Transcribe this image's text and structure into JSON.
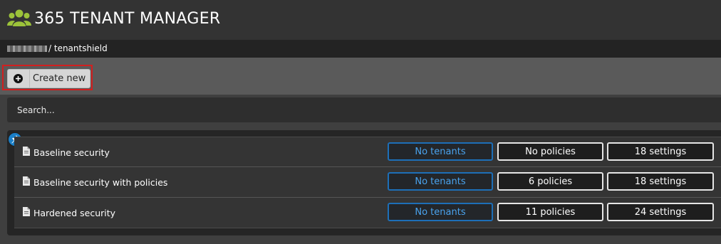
{
  "app": {
    "title": "365 TENANT MANAGER",
    "logo_icon": "users-group-icon",
    "accent_color": "#9cc33a"
  },
  "breadcrumb": {
    "current": "/ tenantshield"
  },
  "toolbar": {
    "create_label": "Create new",
    "create_icon": "plus-circle-icon",
    "highlight_color": "#d21f1f"
  },
  "search": {
    "placeholder": "Search..."
  },
  "list": {
    "pin_icon": "pin-icon",
    "items": [
      {
        "name": "Baseline security",
        "tenants": "No tenants",
        "policies": "No policies",
        "settings": "18 settings"
      },
      {
        "name": "Baseline security with policies",
        "tenants": "No tenants",
        "policies": "6 policies",
        "settings": "18 settings"
      },
      {
        "name": "Hardened security",
        "tenants": "No tenants",
        "policies": "11 policies",
        "settings": "24 settings"
      }
    ]
  },
  "colors": {
    "tenants_blue": "#1d6fb8",
    "pin_blue": "#1a7fc8"
  }
}
